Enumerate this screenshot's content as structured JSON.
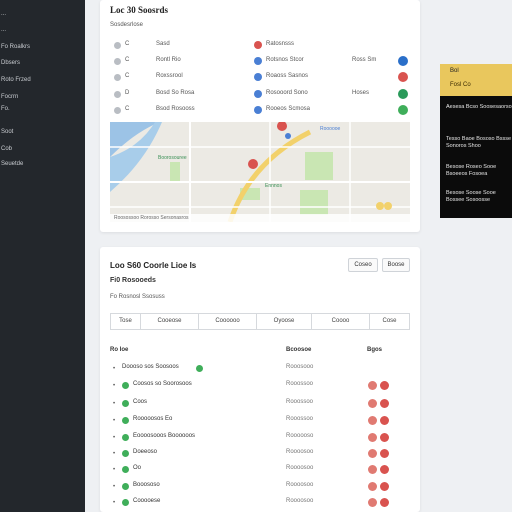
{
  "sidebar": {
    "items": [
      {
        "label": "..."
      },
      {
        "label": "..."
      },
      {
        "label": "Fo Roalkrs"
      },
      {
        "label": "Dbsers"
      },
      {
        "label": "Roto Frzed"
      },
      {
        "label": "Focrrn"
      },
      {
        "label": "Fo."
      },
      {
        "label": "Soot"
      },
      {
        "label": "Cob"
      },
      {
        "label": "Seuetde"
      }
    ]
  },
  "locations_card": {
    "title": "Loc 30 Soosrds",
    "subtitle": "Sosdesrlose",
    "rows": [
      {
        "id": "C",
        "name": "Sasd",
        "pin_color": "#d9534f",
        "address": "Ratosnsss",
        "meta": "",
        "action_color": ""
      },
      {
        "id": "C",
        "name": "Rontl Rio",
        "pin_color": "#4a7fd4",
        "address": "Rotsnos Stcor",
        "meta": "Ross Sm",
        "action_color": "#2a6fc9"
      },
      {
        "id": "C",
        "name": "Roxssrool",
        "pin_color": "#4a7fd4",
        "address": "Roaoss Sasnos",
        "meta": "",
        "action_color": "#d9534f"
      },
      {
        "id": "D",
        "name": "Bosd So Rosa",
        "pin_color": "#4a7fd4",
        "address": "Rosooord Sono",
        "meta": "Hoses",
        "action_color": "#2a9a5a"
      },
      {
        "id": "C",
        "name": "Bsod Rosooss",
        "pin_color": "#4a7fd4",
        "address": "Rooeos Scmosa",
        "meta": "",
        "action_color": "#3fae5a"
      }
    ],
    "map": {
      "labels": [
        "Boorosouree",
        "Ennnos",
        "Roooooe"
      ],
      "footer": "Roosossoo Rorosso Sersonasros"
    }
  },
  "dark_panel": {
    "header_top": "Bol",
    "header_bottom": "Fosl Co",
    "lines": [
      "Aesesa Bcso Soosesaorso",
      "Tesso Baoe Bososo Bssse Sonoros Shoo",
      "Besose Roseo Sooe Bsoeeos Fosoea",
      "Besose Soose Sooe Bossee Sosoosse"
    ]
  },
  "hours_card": {
    "title": "Loo S60  Coorle  Lioe Is",
    "subtitle": "Fi0 Rosooeds",
    "subtitle2": "Fo Rosnosl Ssosuss",
    "buttons": [
      "Coseo",
      "Boose"
    ],
    "filters": [
      "Tose",
      "Cooeose",
      "Coooooo",
      "Oyoose",
      "Coooo",
      "Cose"
    ],
    "columns": {
      "name": "Ro Ioe",
      "status": "Bcoosoe",
      "actions": "Bgos"
    },
    "rows": [
      {
        "name": "Doooso sos Soosoos",
        "status": "Rooosooo"
      },
      {
        "name": "Coosos so Soorosoos",
        "status": "Rooossoo"
      },
      {
        "name": "Coos",
        "status": "Rooossoo"
      },
      {
        "name": "Rooooosos Eo",
        "status": "Rooossoo"
      },
      {
        "name": "Eoooosooos Boooooos",
        "status": "Roooooso"
      },
      {
        "name": "Doeeoso",
        "status": "Roooosoo"
      },
      {
        "name": "Oo",
        "status": "Roooosoo"
      },
      {
        "name": "Booososo",
        "status": "Roooosoo"
      },
      {
        "name": "Cooooese",
        "status": "Roooosoo"
      }
    ]
  }
}
